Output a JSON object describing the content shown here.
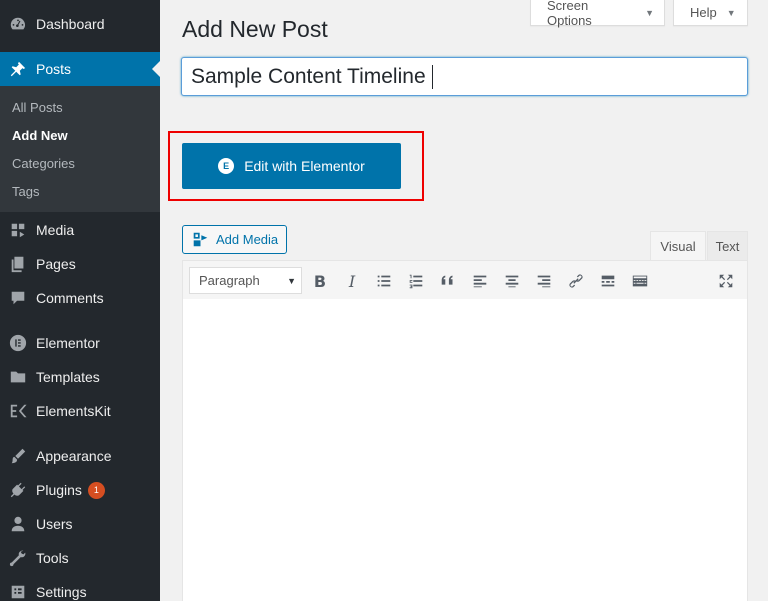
{
  "sidebar": {
    "items": [
      {
        "label": "Dashboard",
        "icon": "dashboard-icon"
      },
      {
        "label": "Posts",
        "icon": "pin-icon"
      },
      {
        "label": "Media",
        "icon": "media-icon"
      },
      {
        "label": "Pages",
        "icon": "pages-icon"
      },
      {
        "label": "Comments",
        "icon": "comments-icon"
      },
      {
        "label": "Elementor",
        "icon": "elementor-icon"
      },
      {
        "label": "Templates",
        "icon": "folder-icon"
      },
      {
        "label": "ElementsKit",
        "icon": "elementskit-icon"
      },
      {
        "label": "Appearance",
        "icon": "brush-icon"
      },
      {
        "label": "Plugins",
        "icon": "plugin-icon",
        "badge": "1"
      },
      {
        "label": "Users",
        "icon": "users-icon"
      },
      {
        "label": "Tools",
        "icon": "wrench-icon"
      },
      {
        "label": "Settings",
        "icon": "settings-icon"
      }
    ],
    "submenu": [
      "All Posts",
      "Add New",
      "Categories",
      "Tags"
    ]
  },
  "header": {
    "screen_options": "Screen Options",
    "help": "Help",
    "title": "Add New Post"
  },
  "post": {
    "title_value": "Sample Content Timeline"
  },
  "elementor_button": "Edit with Elementor",
  "editor": {
    "add_media": "Add Media",
    "tab_visual": "Visual",
    "tab_text": "Text",
    "format_select": "Paragraph"
  },
  "colors": {
    "sidebar_bg": "#23282d",
    "accent": "#0073aa",
    "highlight_border": "#ee0000",
    "badge": "#d54e21"
  }
}
